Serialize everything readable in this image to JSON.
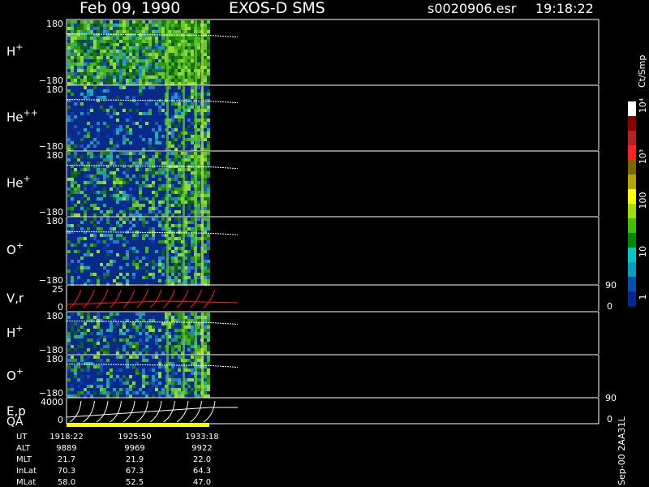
{
  "header": {
    "date": "Feb 09, 1990",
    "mission": "EXOS-D SMS",
    "file": "s0020906.esr",
    "time": "19:18:22"
  },
  "panels": [
    {
      "id": "h-plus",
      "label": "H",
      "sup": "+",
      "ytop": "180",
      "ybot": "−180",
      "kind": "spectrogram",
      "green": 0.9
    },
    {
      "id": "he-plus-plus",
      "label": "He",
      "sup": "++",
      "ytop": "180",
      "ybot": "−180",
      "kind": "spectrogram",
      "green": 0.1
    },
    {
      "id": "he-plus",
      "label": "He",
      "sup": "+",
      "ytop": "180",
      "ybot": "−180",
      "kind": "spectrogram",
      "green": 0.35
    },
    {
      "id": "o-plus",
      "label": "O",
      "sup": "+",
      "ytop": "180",
      "ybot": "−180",
      "kind": "spectrogram",
      "green": 0.2
    },
    {
      "id": "v-r",
      "label": "V,r",
      "sup": "",
      "ytop": "25",
      "ybot": "0",
      "kind": "line",
      "right_top": "90",
      "right_bot": "0"
    },
    {
      "id": "h-plus-2",
      "label": "H",
      "sup": "+",
      "ytop": "180",
      "ybot": "−180",
      "kind": "spectrogram",
      "green": 0.3
    },
    {
      "id": "o-plus-2",
      "label": "O",
      "sup": "+",
      "ytop": "180",
      "ybot": "−180",
      "kind": "spectrogram",
      "green": 0.25
    },
    {
      "id": "e-p",
      "label": "E,p",
      "sup": "",
      "ytop": "4000",
      "ybot": "0",
      "kind": "line",
      "right_top": "90",
      "right_bot": "0"
    }
  ],
  "qa_label": "QA",
  "colorbar": {
    "unit": "Ct/Smp",
    "ticks": [
      "10⁴",
      "10³",
      "100",
      "10",
      "1"
    ],
    "colors": [
      "#ffffff",
      "#8b0000",
      "#b22222",
      "#ff2020",
      "#7a6a00",
      "#b8a400",
      "#ffff00",
      "#a0e000",
      "#40c000",
      "#008a00",
      "#00c8c8",
      "#00a0c0",
      "#0050b0",
      "#002a90"
    ]
  },
  "ephemeris": {
    "labels": [
      "UT",
      "ALT",
      "MLT",
      "InLat",
      "MLat"
    ],
    "columns": [
      [
        "1918:22",
        "9889",
        "21.7",
        "70.3",
        "58.0"
      ],
      [
        "1925:50",
        "9969",
        "21.9",
        "67.3",
        "52.5"
      ],
      [
        "1933:18",
        "9922",
        "22.0",
        "64.3",
        "47.0"
      ]
    ]
  },
  "footer_id": "Sep-00  2AA31L",
  "chart_data": {
    "type": "heatmap",
    "title": "Feb 09, 1990   EXOS-D SMS",
    "xlabel": "UT",
    "x_ticks": [
      "1918:22",
      "1925:50",
      "1933:18"
    ],
    "colorbar_unit": "Ct/Smp",
    "colorbar_scale": "log",
    "colorbar_range": [
      1,
      10000
    ],
    "series": [
      {
        "name": "H+",
        "ylim": [
          -180,
          180
        ]
      },
      {
        "name": "He++",
        "ylim": [
          -180,
          180
        ]
      },
      {
        "name": "He+",
        "ylim": [
          -180,
          180
        ]
      },
      {
        "name": "O+",
        "ylim": [
          -180,
          180
        ]
      },
      {
        "name": "V,r",
        "ylim": [
          0,
          25
        ],
        "right_ylim": [
          0,
          90
        ]
      },
      {
        "name": "H+",
        "ylim": [
          -180,
          180
        ]
      },
      {
        "name": "O+",
        "ylim": [
          -180,
          180
        ]
      },
      {
        "name": "E,p",
        "ylim": [
          0,
          4000
        ],
        "right_ylim": [
          0,
          90
        ]
      }
    ]
  }
}
